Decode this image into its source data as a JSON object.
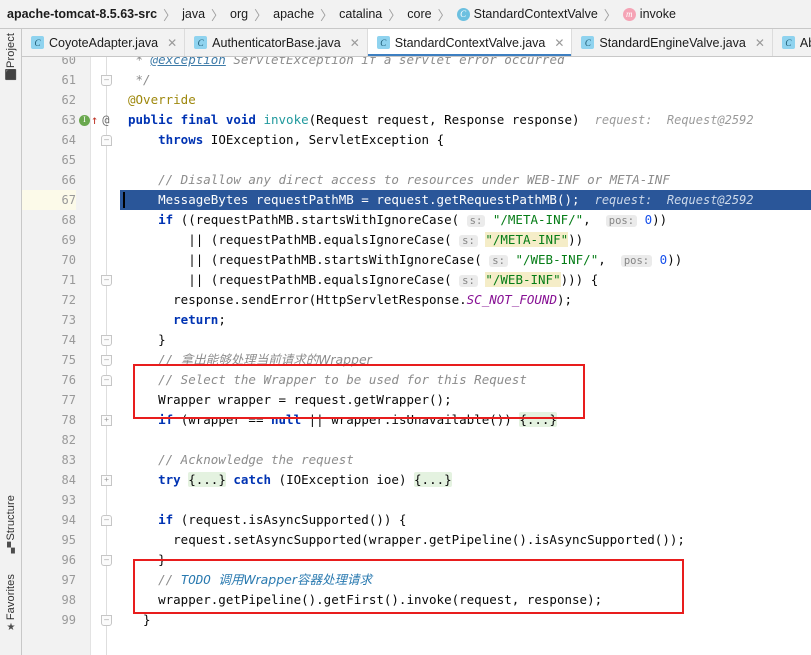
{
  "breadcrumb": {
    "name": "breadcrumb",
    "items": [
      {
        "label": "apache-tomcat-8.5.63-src",
        "icon": "",
        "root": true
      },
      {
        "label": "java",
        "icon": ""
      },
      {
        "label": "org",
        "icon": ""
      },
      {
        "label": "apache",
        "icon": ""
      },
      {
        "label": "catalina",
        "icon": ""
      },
      {
        "label": "core",
        "icon": ""
      },
      {
        "label": "StandardContextValve",
        "icon": "class-icon",
        "glyph": "C"
      },
      {
        "label": "invoke",
        "icon": "method-icon",
        "glyph": "m"
      }
    ],
    "separator": "〉"
  },
  "tabs": {
    "items": [
      {
        "label": "CoyoteAdapter.java",
        "glyph": "C",
        "active": false,
        "close": "✕"
      },
      {
        "label": "AuthenticatorBase.java",
        "glyph": "C",
        "active": false,
        "close": "✕"
      },
      {
        "label": "StandardContextValve.java",
        "glyph": "C",
        "active": true,
        "close": "✕"
      },
      {
        "label": "StandardEngineValve.java",
        "glyph": "C",
        "active": false,
        "close": "✕"
      },
      {
        "label": "Abs",
        "glyph": "C",
        "active": false,
        "close": ""
      }
    ]
  },
  "tool_windows": {
    "project": {
      "label": "Project",
      "icon": "folder-icon",
      "glyph": "⬛"
    },
    "structure": {
      "label": "Structure",
      "icon": "structure-icon",
      "glyph": "▚"
    },
    "favorites": {
      "label": "Favorites",
      "icon": "star-icon",
      "glyph": "★"
    }
  },
  "editor": {
    "current_line": 67,
    "debug_hint_line_63": "request:  Request@2592",
    "debug_hint_line_67": "request:  Request@2592",
    "gutter_markers": {
      "implements_icon": "I",
      "override_arrow": "↑",
      "annotation_mark": "@"
    },
    "lines": [
      {
        "n": "60",
        "fold": "",
        "text": "  * @exception ServletException if a servlet error occurred"
      },
      {
        "n": "61",
        "fold": "cap-bot",
        "text": "  */"
      },
      {
        "n": "62",
        "fold": "",
        "text": "  @Override"
      },
      {
        "n": "63",
        "fold": "",
        "text": "  public final void invoke(Request request, Response response)"
      },
      {
        "n": "64",
        "fold": "minus",
        "text": "      throws IOException, ServletException {"
      },
      {
        "n": "65",
        "fold": "",
        "text": ""
      },
      {
        "n": "66",
        "fold": "",
        "text": "      // Disallow any direct access to resources under WEB-INF or META-INF"
      },
      {
        "n": "67",
        "fold": "",
        "text": "      MessageBytes requestPathMB = request.getRequestPathMB();"
      },
      {
        "n": "68",
        "fold": "",
        "text": "      if ((requestPathMB.startsWithIgnoreCase( s: \"/META-INF/\",  pos: 0))"
      },
      {
        "n": "69",
        "fold": "",
        "text": "            || (requestPathMB.equalsIgnoreCase( s: \"/META-INF\"))"
      },
      {
        "n": "70",
        "fold": "",
        "text": "            || (requestPathMB.startsWithIgnoreCase( s: \"/WEB-INF/\",  pos: 0))"
      },
      {
        "n": "71",
        "fold": "cap-bot",
        "text": "            || (requestPathMB.equalsIgnoreCase( s: \"/WEB-INF\"))) {"
      },
      {
        "n": "72",
        "fold": "",
        "text": "          response.sendError(HttpServletResponse.SC_NOT_FOUND);"
      },
      {
        "n": "73",
        "fold": "",
        "text": "          return;"
      },
      {
        "n": "74",
        "fold": "cap-bot",
        "text": "      }"
      },
      {
        "n": "75",
        "fold": "cap-bot",
        "text": "      // 拿出能够处理当前请求的Wrapper"
      },
      {
        "n": "76",
        "fold": "cap-top",
        "text": "      // Select the Wrapper to be used for this Request"
      },
      {
        "n": "77",
        "fold": "",
        "text": "      Wrapper wrapper = request.getWrapper();"
      },
      {
        "n": "78",
        "fold": "plus",
        "text": "      if (wrapper == null || wrapper.isUnavailable()) {...}"
      },
      {
        "n": "82",
        "fold": "",
        "text": ""
      },
      {
        "n": "83",
        "fold": "",
        "text": "      // Acknowledge the request"
      },
      {
        "n": "84",
        "fold": "plus",
        "text": "      try {...} catch (IOException ioe) {...}"
      },
      {
        "n": "93",
        "fold": "",
        "text": ""
      },
      {
        "n": "94",
        "fold": "minus",
        "text": "      if (request.isAsyncSupported()) {"
      },
      {
        "n": "95",
        "fold": "",
        "text": "          request.setAsyncSupported(wrapper.getPipeline().isAsyncSupported());"
      },
      {
        "n": "96",
        "fold": "cap-bot",
        "text": "      }"
      },
      {
        "n": "97",
        "fold": "",
        "text": "      // TODO 调用Wrapper容器处理请求"
      },
      {
        "n": "98",
        "fold": "",
        "text": "      wrapper.getPipeline().getFirst().invoke(request, response);"
      },
      {
        "n": "99",
        "fold": "cap-bot",
        "text": "  }"
      }
    ],
    "annotations": [
      {
        "name": "red-box-wrapper-comment",
        "covers": "lines 75-77"
      },
      {
        "name": "red-box-todo-invoke",
        "covers": "lines 96-98"
      }
    ],
    "colors": {
      "exec_line_bg": "#2a5699",
      "current_line_gutter": "#fcfae9",
      "keyword": "#0033b3",
      "string": "#067d17",
      "string_highlight": "#f5edc8",
      "comment": "#8c8c8c",
      "todo": "#2a7ab0",
      "static_field": "#871094",
      "annotation": "#9e880d",
      "number": "#1750eb",
      "fold_chip": "#e4f2e0",
      "annotation_box": "#e81d1d"
    }
  }
}
